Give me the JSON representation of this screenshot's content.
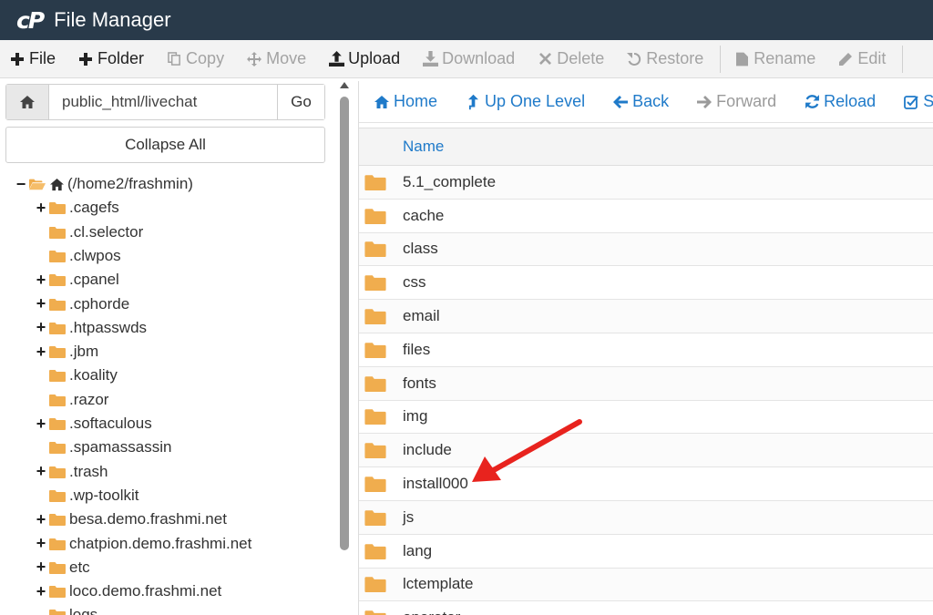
{
  "app": {
    "logo": "cP",
    "title": "File Manager"
  },
  "toolbar": [
    {
      "label": "File",
      "icon": "plus-icon",
      "enabled": true
    },
    {
      "label": "Folder",
      "icon": "plus-icon",
      "enabled": true
    },
    {
      "label": "Copy",
      "icon": "copy-icon",
      "enabled": false
    },
    {
      "label": "Move",
      "icon": "move-icon",
      "enabled": false
    },
    {
      "label": "Upload",
      "icon": "upload-icon",
      "enabled": true
    },
    {
      "label": "Download",
      "icon": "download-icon",
      "enabled": false
    },
    {
      "label": "Delete",
      "icon": "delete-icon",
      "enabled": false
    },
    {
      "label": "Restore",
      "icon": "restore-icon",
      "enabled": false
    },
    {
      "label": "Rename",
      "icon": "rename-icon",
      "enabled": false
    },
    {
      "label": "Edit",
      "icon": "edit-icon",
      "enabled": false
    }
  ],
  "sidebar": {
    "path_value": "public_html/livechat",
    "go_label": "Go",
    "collapse_label": "Collapse All",
    "tree": [
      {
        "label": "(/home2/frashmin)",
        "toggle": "−",
        "level": 0,
        "root": true
      },
      {
        "label": ".cagefs",
        "toggle": "+",
        "level": 1
      },
      {
        "label": ".cl.selector",
        "toggle": "",
        "level": 1
      },
      {
        "label": ".clwpos",
        "toggle": "",
        "level": 1
      },
      {
        "label": ".cpanel",
        "toggle": "+",
        "level": 1
      },
      {
        "label": ".cphorde",
        "toggle": "+",
        "level": 1
      },
      {
        "label": ".htpasswds",
        "toggle": "+",
        "level": 1
      },
      {
        "label": ".jbm",
        "toggle": "+",
        "level": 1
      },
      {
        "label": ".koality",
        "toggle": "",
        "level": 1
      },
      {
        "label": ".razor",
        "toggle": "",
        "level": 1
      },
      {
        "label": ".softaculous",
        "toggle": "+",
        "level": 1
      },
      {
        "label": ".spamassassin",
        "toggle": "",
        "level": 1
      },
      {
        "label": ".trash",
        "toggle": "+",
        "level": 1
      },
      {
        "label": ".wp-toolkit",
        "toggle": "",
        "level": 1
      },
      {
        "label": "besa.demo.frashmi.net",
        "toggle": "+",
        "level": 1
      },
      {
        "label": "chatpion.demo.frashmi.net",
        "toggle": "+",
        "level": 1
      },
      {
        "label": "etc",
        "toggle": "+",
        "level": 1
      },
      {
        "label": "loco.demo.frashmi.net",
        "toggle": "+",
        "level": 1
      },
      {
        "label": "logs",
        "toggle": "",
        "level": 1
      }
    ]
  },
  "nav": [
    {
      "label": "Home",
      "icon": "home-icon",
      "enabled": true
    },
    {
      "label": "Up One Level",
      "icon": "up-arrow-icon",
      "enabled": true
    },
    {
      "label": "Back",
      "icon": "back-arrow-icon",
      "enabled": true
    },
    {
      "label": "Forward",
      "icon": "forward-arrow-icon",
      "enabled": false
    },
    {
      "label": "Reload",
      "icon": "reload-icon",
      "enabled": true
    },
    {
      "label": "Select All",
      "icon": "checkbox-icon",
      "enabled": true
    }
  ],
  "files": {
    "header_name": "Name",
    "rows": [
      "5.1_complete",
      "cache",
      "class",
      "css",
      "email",
      "files",
      "fonts",
      "img",
      "include",
      "install000",
      "js",
      "lang",
      "lctemplate",
      "operator"
    ]
  },
  "colors": {
    "titlebar": "#293a4a",
    "link": "#1f7ac9",
    "folder": "#f0ad4e",
    "annotation_arrow": "#e8231e"
  }
}
